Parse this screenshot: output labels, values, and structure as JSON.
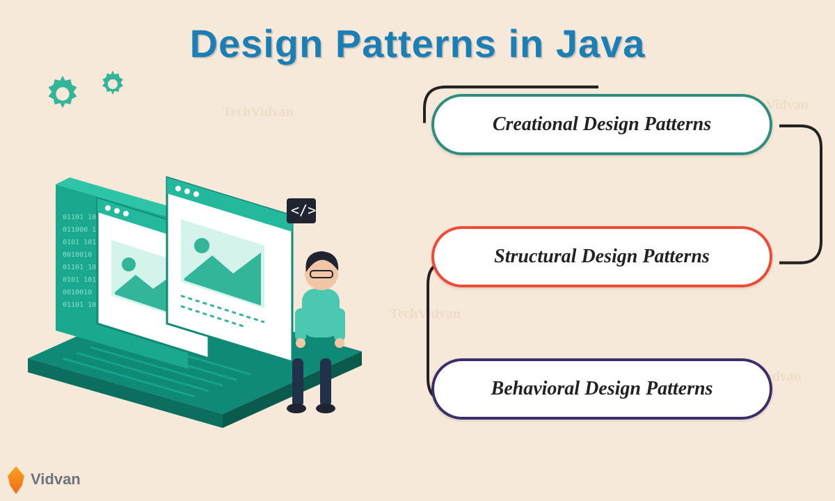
{
  "title": "Design Patterns in Java",
  "categories": [
    {
      "label": "Creational Design Patterns",
      "border": "#2e8e7e"
    },
    {
      "label": "Structural Design Patterns",
      "border": "#ef4a33"
    },
    {
      "label": "Behavioral Design Patterns",
      "border": "#3a2f6a"
    }
  ],
  "brand": "Vidvan",
  "watermark_text": "TechVidvan",
  "illustration": "isometric-laptop-with-code-windows-and-person",
  "icons": {
    "gear_large": "gear-icon",
    "gear_small": "gear-icon",
    "code_tag": "code-tag-icon"
  }
}
